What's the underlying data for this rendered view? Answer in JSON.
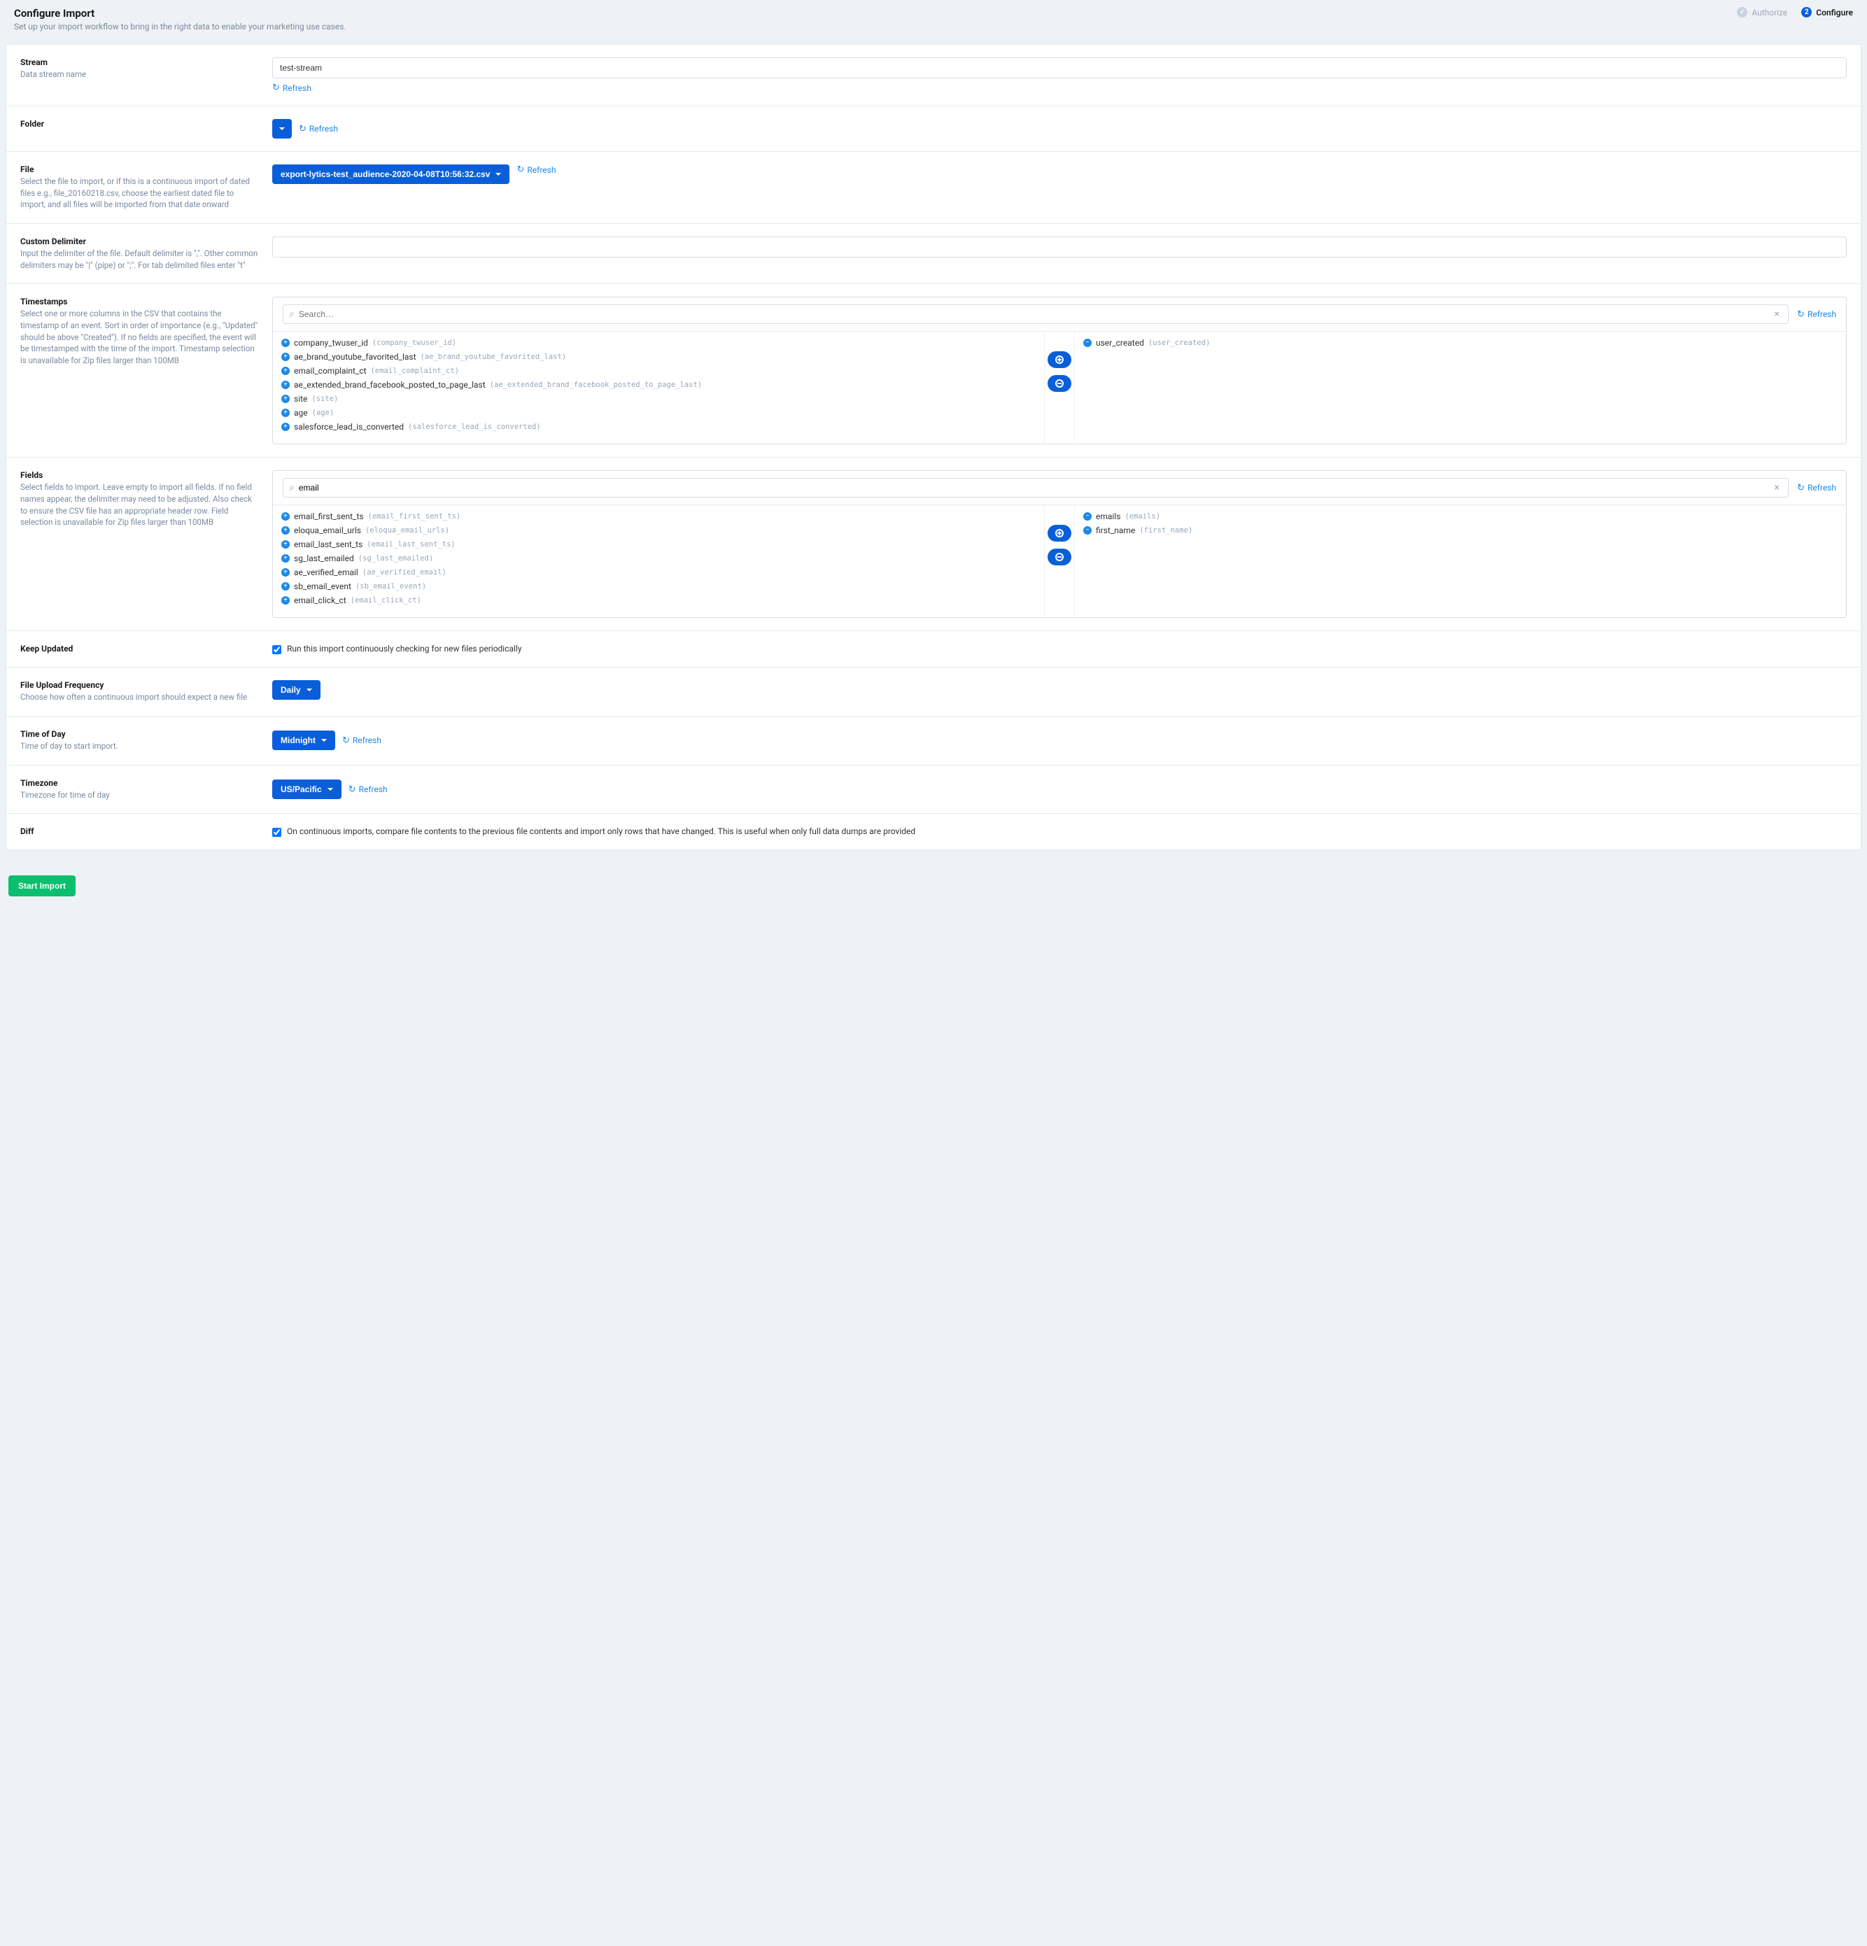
{
  "header": {
    "title": "Configure Import",
    "subtitle": "Set up your import workflow to bring in the right data to enable your marketing use cases."
  },
  "steps": {
    "done_badge": "✓",
    "done_label": "Authorize",
    "active_badge": "2",
    "active_label": "Configure"
  },
  "common": {
    "refresh": "Refresh"
  },
  "stream": {
    "label": "Stream",
    "help": "Data stream name",
    "value": "test-stream"
  },
  "folder": {
    "label": "Folder"
  },
  "file": {
    "label": "File",
    "help": "Select the file to import, or if this is a continuous import of dated files e.g., file_20160218.csv, choose the earliest dated file to import, and all files will be imported from that date onward",
    "selected": "export-lytics-test_audience-2020-04-08T10:56:32.csv"
  },
  "delimiter": {
    "label": "Custom Delimiter",
    "help": "Input the delimiter of the file. Default delimiter is \",\". Other common delimiters may be \"|\" (pipe) or \";\". For tab delimited files enter \"t\"",
    "value": ""
  },
  "timestamps": {
    "label": "Timestamps",
    "help": "Select one or more columns in the CSV that contains the timestamp of an event. Sort in order of importance (e.g., \"Updated\" should be above \"Created\"). If no fields are specified, the event will be timestamped with the time of the import. Timestamp selection is unavailable for Zip files larger than 100MB",
    "search_placeholder": "Search…",
    "available": [
      {
        "name": "company_twuser_id",
        "slug": "company_twuser_id"
      },
      {
        "name": "ae_brand_youtube_favorited_last",
        "slug": "ae_brand_youtube_favorited_last"
      },
      {
        "name": "email_complaint_ct",
        "slug": "email_complaint_ct"
      },
      {
        "name": "ae_extended_brand_facebook_posted_to_page_last",
        "slug": "ae_extended_brand_facebook_posted_to_page_last"
      },
      {
        "name": "site",
        "slug": "site"
      },
      {
        "name": "age",
        "slug": "age"
      },
      {
        "name": "salesforce_lead_is_converted",
        "slug": "salesforce_lead_is_converted"
      }
    ],
    "selected": [
      {
        "name": "user_created",
        "slug": "user_created"
      }
    ]
  },
  "fields": {
    "label": "Fields",
    "help": "Select fields to import. Leave empty to import all fields. If no field names appear, the delimiter may need to be adjusted. Also check to ensure the CSV file has an appropriate header row. Field selection is unavailable for Zip files larger than 100MB",
    "search_value": "email",
    "available": [
      {
        "name": "email_first_sent_ts",
        "slug": "email_first_sent_ts"
      },
      {
        "name": "eloqua_email_urls",
        "slug": "eloqua_email_urls"
      },
      {
        "name": "email_last_sent_ts",
        "slug": "email_last_sent_ts"
      },
      {
        "name": "sg_last_emailed",
        "slug": "sg_last_emailed"
      },
      {
        "name": "ae_verified_email",
        "slug": "ae_verified_email"
      },
      {
        "name": "sb_email_event",
        "slug": "sb_email_event"
      },
      {
        "name": "email_click_ct",
        "slug": "email_click_ct"
      }
    ],
    "selected": [
      {
        "name": "emails",
        "slug": "emails"
      },
      {
        "name": "first_name",
        "slug": "first_name"
      }
    ]
  },
  "keep_updated": {
    "label": "Keep Updated",
    "text": "Run this import continuously checking for new files periodically"
  },
  "frequency": {
    "label": "File Upload Frequency",
    "help": "Choose how often a continuous import should expect a new file",
    "value": "Daily"
  },
  "time_of_day": {
    "label": "Time of Day",
    "help": "Time of day to start import.",
    "value": "Midnight"
  },
  "timezone": {
    "label": "Timezone",
    "help": "Timezone for time of day",
    "value": "US/Pacific"
  },
  "diff": {
    "label": "Diff",
    "text": "On continuous imports, compare file contents to the previous file contents and import only rows that have changed. This is useful when only full data dumps are provided"
  },
  "footer": {
    "start": "Start Import"
  }
}
